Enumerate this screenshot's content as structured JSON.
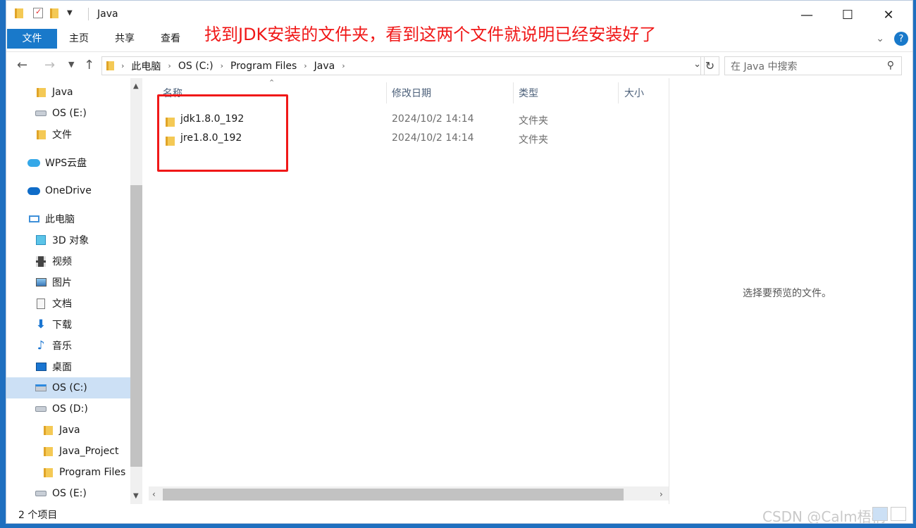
{
  "titlebar": {
    "title": "Java",
    "controls": {
      "minimize": "—",
      "maximize": "☐",
      "close": "✕"
    }
  },
  "ribbon": {
    "tabs": [
      "文件",
      "主页",
      "共享",
      "查看"
    ],
    "annotation": "找到JDK安装的文件夹，看到这两个文件就说明已经安装好了"
  },
  "address": {
    "crumbs": [
      "此电脑",
      "OS (C:)",
      "Program Files",
      "Java"
    ],
    "search_placeholder": "在 Java 中搜索"
  },
  "nav": {
    "items": [
      {
        "label": "Java",
        "icon": "folder-icon"
      },
      {
        "label": "OS (E:)",
        "icon": "drive-icon"
      },
      {
        "label": "文件",
        "icon": "folder-icon"
      },
      {
        "label": "WPS云盘",
        "icon": "cloud-icon"
      },
      {
        "label": "OneDrive",
        "icon": "cloud-icon"
      },
      {
        "label": "此电脑",
        "icon": "computer-icon"
      },
      {
        "label": "3D 对象",
        "icon": "cube-icon"
      },
      {
        "label": "视频",
        "icon": "video-icon"
      },
      {
        "label": "图片",
        "icon": "picture-icon"
      },
      {
        "label": "文档",
        "icon": "document-icon"
      },
      {
        "label": "下载",
        "icon": "download-icon"
      },
      {
        "label": "音乐",
        "icon": "music-icon"
      },
      {
        "label": "桌面",
        "icon": "desktop-icon"
      },
      {
        "label": "OS (C:)",
        "icon": "drive-icon"
      },
      {
        "label": "OS (D:)",
        "icon": "drive-icon"
      },
      {
        "label": "Java",
        "icon": "folder-icon"
      },
      {
        "label": "Java_Project",
        "icon": "folder-icon"
      },
      {
        "label": "Program Files",
        "icon": "folder-icon"
      },
      {
        "label": "OS (E:)",
        "icon": "drive-icon"
      }
    ]
  },
  "files": {
    "columns": [
      "名称",
      "修改日期",
      "类型",
      "大小"
    ],
    "rows": [
      {
        "name": "jdk1.8.0_192",
        "modified": "2024/10/2 14:14",
        "type": "文件夹",
        "size": ""
      },
      {
        "name": "jre1.8.0_192",
        "modified": "2024/10/2 14:14",
        "type": "文件夹",
        "size": ""
      }
    ]
  },
  "preview": {
    "text": "选择要预览的文件。"
  },
  "status": {
    "count": "2 个项目",
    "watermark": "CSDN @Calm梧桐"
  },
  "colors": {
    "accent": "#1979ca",
    "annotation": "#f01818",
    "selected": "#cce0f5"
  }
}
